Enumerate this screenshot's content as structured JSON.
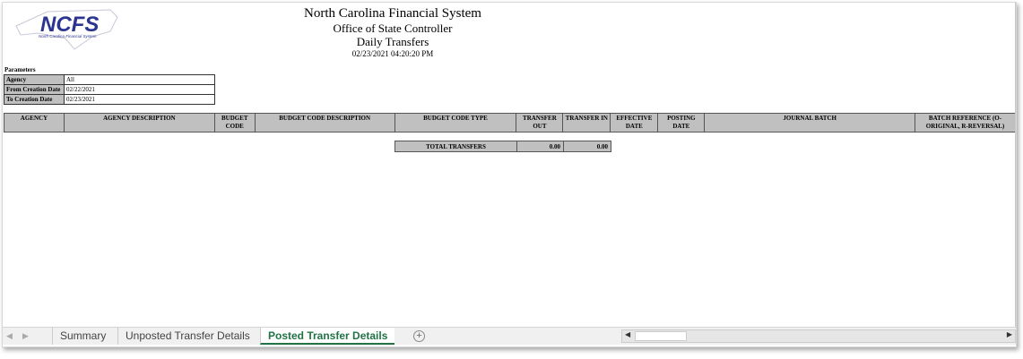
{
  "header": {
    "logo_text": "NCFS",
    "logo_subtitle": "North Carolina Financial System",
    "title": "North Carolina Financial System",
    "subtitle": "Office of State Controller",
    "report": "Daily Transfers",
    "timestamp": "02/23/2021 04:20:20 PM"
  },
  "parameters": {
    "label": "Parameters",
    "rows": [
      {
        "k": "Agency",
        "v": "All"
      },
      {
        "k": "From Creation Date",
        "v": "02/22/2021"
      },
      {
        "k": "To Creation Date",
        "v": "02/23/2021"
      }
    ]
  },
  "columns": [
    "AGENCY",
    "AGENCY DESCRIPTION",
    "BUDGET CODE",
    "BUDGET CODE DESCRIPTION",
    "BUDGET CODE TYPE",
    "TRANSFER OUT",
    "TRANSFER IN",
    "EFFECTIVE DATE",
    "POSTING DATE",
    "JOURNAL BATCH",
    "BATCH REFERENCE (O-ORIGINAL, R-REVERSAL)"
  ],
  "totals": {
    "label": "TOTAL TRANSFERS",
    "out": "0.00",
    "in": "0.00"
  },
  "tabs": [
    "Summary",
    "Unposted Transfer Details",
    "Posted Transfer Details"
  ],
  "add_sheet": "+"
}
